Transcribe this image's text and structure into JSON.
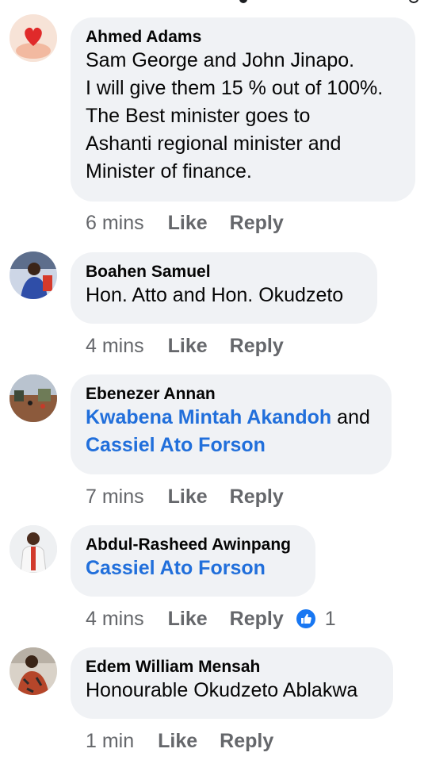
{
  "comments": [
    {
      "author": "Ahmed Adams",
      "lines": [
        "Sam George and John Jinapo.",
        "I will give them 15 % out of 100%.",
        "The Best minister goes to",
        "Ashanti regional minister and",
        "Minister of finance."
      ],
      "time": "6 mins",
      "like": "Like",
      "reply": "Reply"
    },
    {
      "author": "Boahen Samuel",
      "lines": [
        "Hon. Atto and Hon. Okudzeto"
      ],
      "time": "4 mins",
      "like": "Like",
      "reply": "Reply"
    },
    {
      "author": "Ebenezer Annan",
      "mention1": "Kwabena Mintah Akandoh",
      "connector": " and",
      "mention2": "Cassiel Ato Forson",
      "time": "7 mins",
      "like": "Like",
      "reply": "Reply"
    },
    {
      "author": "Abdul-Rasheed Awinpang",
      "mention1": "Cassiel Ato Forson",
      "time": "4 mins",
      "like": "Like",
      "reply": "Reply",
      "reaction_count": "1"
    },
    {
      "author": "Edem William Mensah",
      "lines": [
        "Honourable Okudzeto Ablakwa"
      ],
      "time": "1 min",
      "like": "Like",
      "reply": "Reply"
    }
  ],
  "colors": {
    "link": "#216fdb",
    "bubble": "#f0f2f5",
    "meta": "#65676b",
    "like_blue": "#1877f2"
  }
}
